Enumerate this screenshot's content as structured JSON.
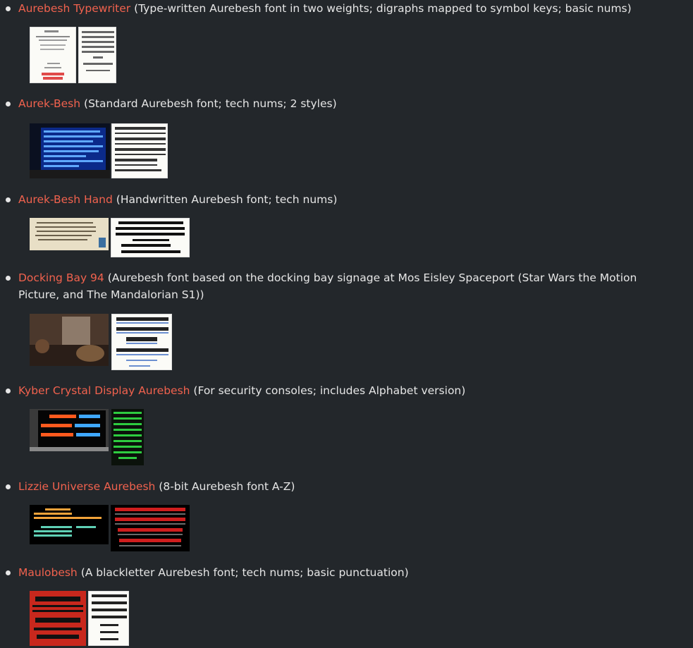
{
  "items": [
    {
      "title": "Aurebesh Typewriter",
      "desc": "(Type-written Aurebesh font in two weights; digraphs mapped to symbol keys; basic nums)"
    },
    {
      "title": "Aurek-Besh",
      "desc": "(Standard Aurebesh font; tech nums; 2 styles)"
    },
    {
      "title": "Aurek-Besh Hand",
      "desc": "(Handwritten Aurebesh font; tech nums)"
    },
    {
      "title": "Docking Bay 94",
      "desc": "(Aurebesh font based on the docking bay signage at Mos Eisley Spaceport (Star Wars the Motion Picture, and The Mandalorian S1))"
    },
    {
      "title": "Kyber Crystal Display Aurebesh",
      "desc": "(For security consoles; includes Alphabet version)"
    },
    {
      "title": "Lizzie Universe Aurebesh",
      "desc": "(8-bit Aurebesh font A-Z)"
    },
    {
      "title": "Maulobesh",
      "desc": "(A blackletter Aurebesh font; tech nums; basic punctuation)"
    }
  ],
  "colors": {
    "background": "#23272b",
    "link": "#f1624e",
    "text": "#e6e6e6"
  }
}
